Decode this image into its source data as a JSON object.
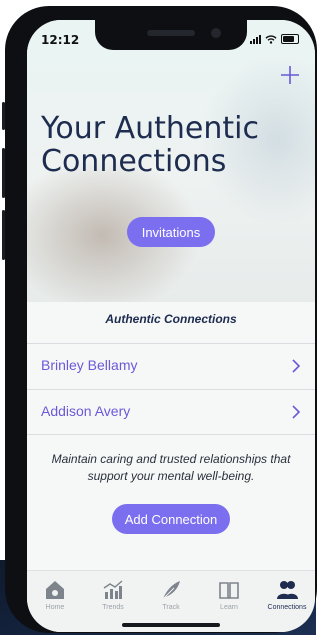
{
  "status": {
    "time": "12:12"
  },
  "header": {
    "title": "Your Authentic Connections",
    "add_icon": "plus-icon"
  },
  "invitations_button": {
    "label": "Invitations"
  },
  "section": {
    "title": "Authentic Connections"
  },
  "connections": [
    {
      "name": "Brinley Bellamy"
    },
    {
      "name": "Addison Avery"
    }
  ],
  "description": "Maintain caring and trusted relationships that support your mental well-being.",
  "add_connection_button": {
    "label": "Add Connection"
  },
  "tabs": [
    {
      "label": "Home",
      "icon": "home-icon",
      "active": false
    },
    {
      "label": "Trends",
      "icon": "trends-chart-icon",
      "active": false
    },
    {
      "label": "Track",
      "icon": "feather-icon",
      "active": false
    },
    {
      "label": "Learn",
      "icon": "book-icon",
      "active": false
    },
    {
      "label": "Connections",
      "icon": "people-icon",
      "active": true
    }
  ],
  "colors": {
    "accent": "#7b6ff0",
    "link": "#6a59d8",
    "title": "#1d2c4f"
  }
}
